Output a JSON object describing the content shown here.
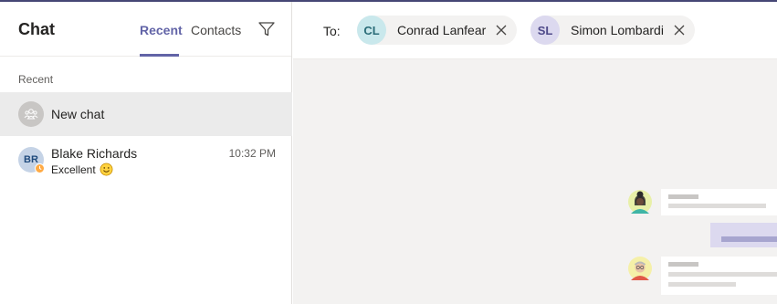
{
  "left": {
    "title": "Chat",
    "tabs": [
      {
        "label": "Recent",
        "active": true
      },
      {
        "label": "Contacts",
        "active": false
      }
    ],
    "filter_icon": "filter-icon",
    "section_label": "Recent",
    "new_chat": {
      "label": "New chat",
      "icon": "people-icon"
    },
    "conversations": [
      {
        "initials": "BR",
        "name": "Blake Richards",
        "time": "10:32 PM",
        "preview": "Excellent",
        "preview_emoji": "smile-emoji",
        "presence": "away"
      }
    ]
  },
  "compose": {
    "to_label": "To:",
    "recipients": [
      {
        "initials": "CL",
        "name": "Conrad Lanfear"
      },
      {
        "initials": "SL",
        "name": "Simon Lombardi"
      }
    ]
  },
  "colors": {
    "accent": "#6264a7",
    "top_border": "#464775",
    "presence_away": "#ffaa44",
    "right_bg": "#f3f2f1"
  }
}
